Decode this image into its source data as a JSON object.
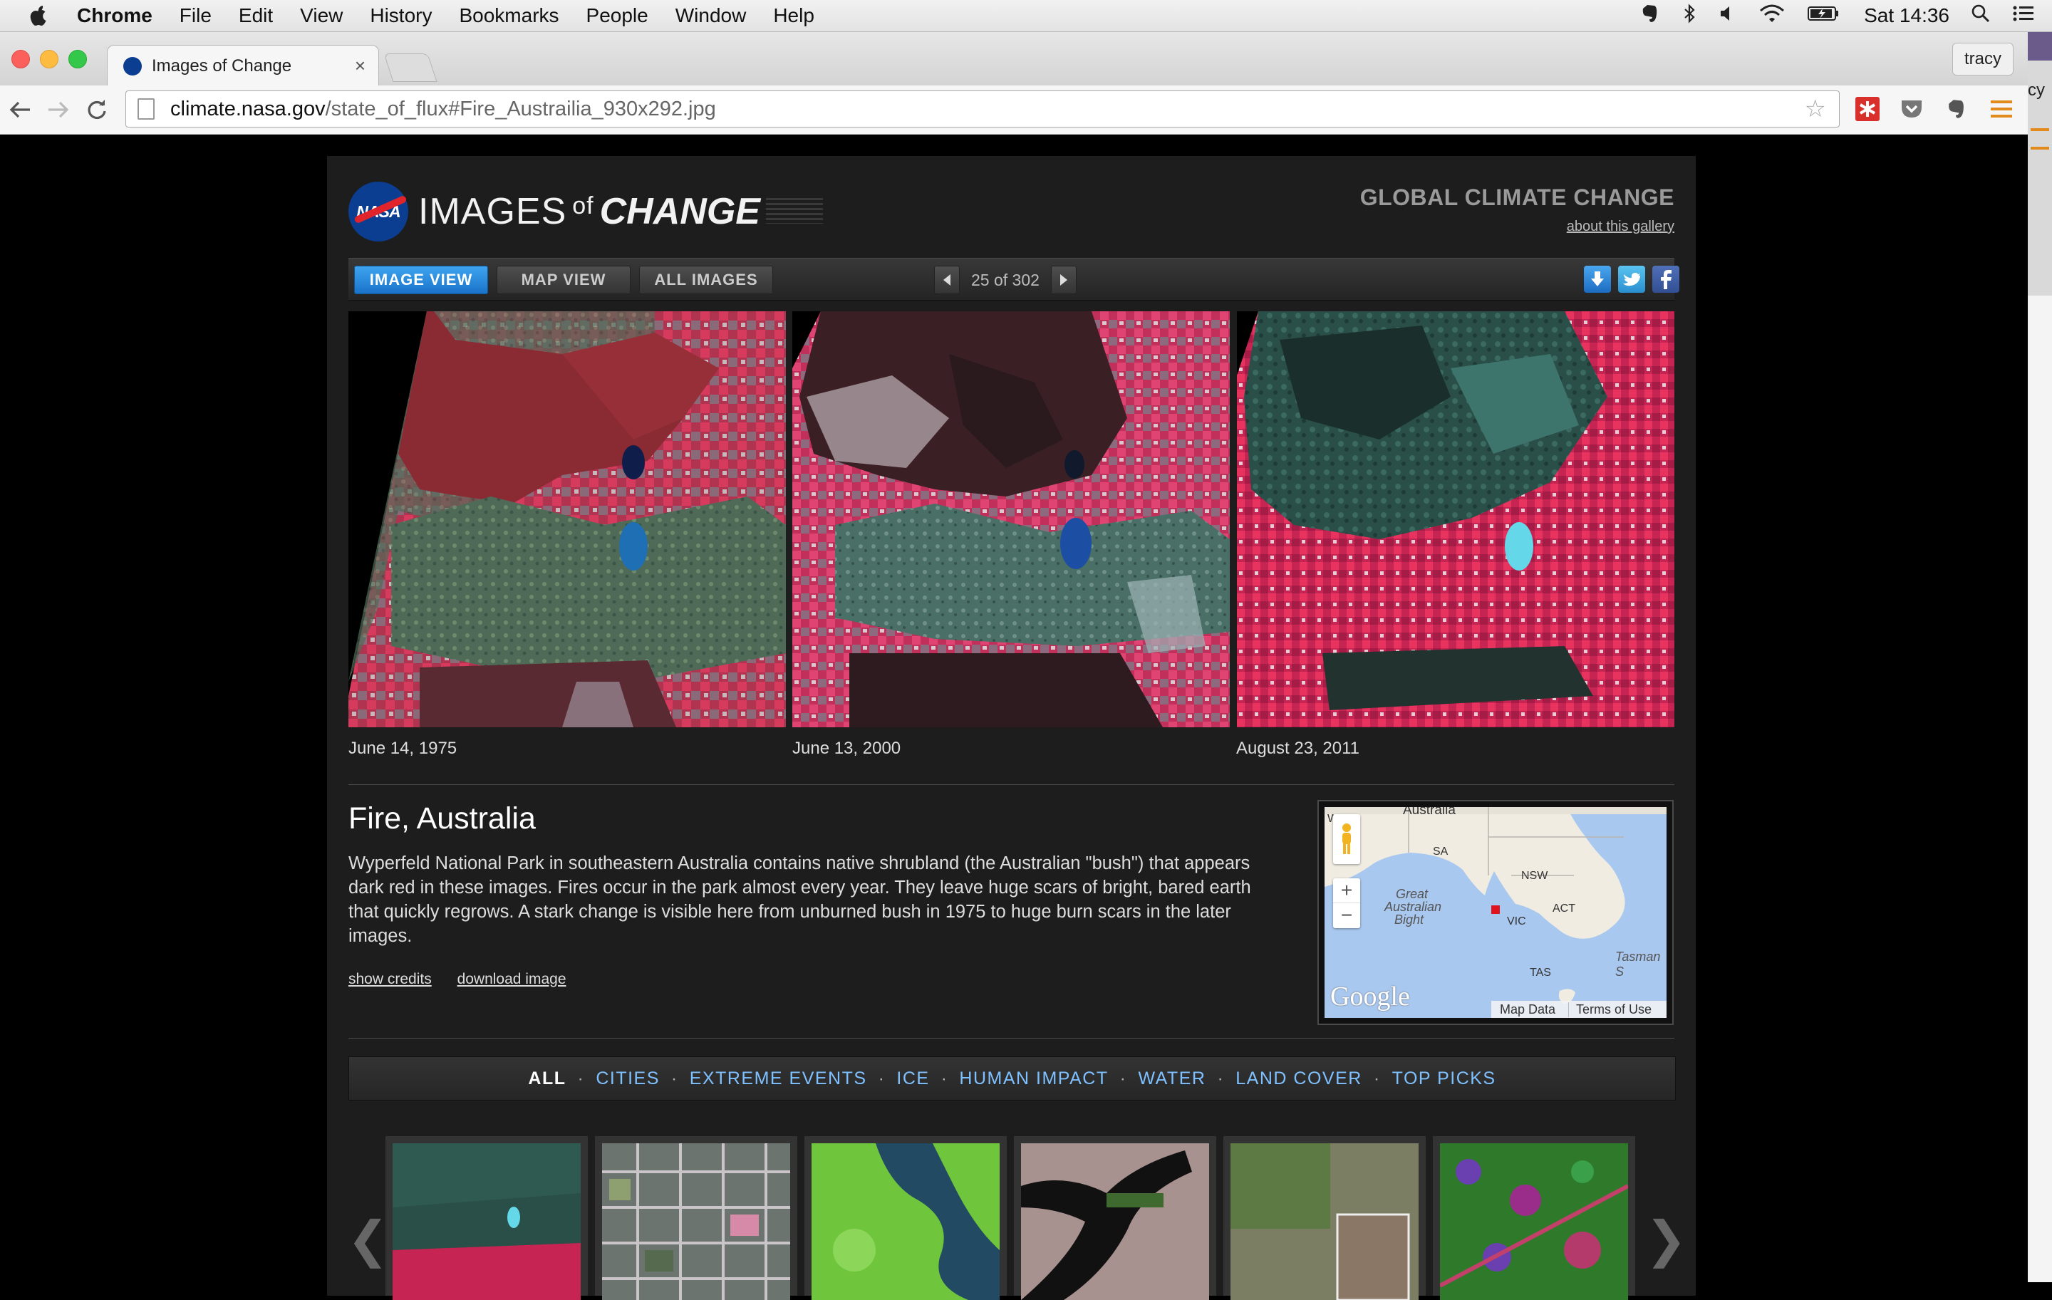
{
  "menubar": {
    "app_name": "Chrome",
    "items": [
      "File",
      "Edit",
      "View",
      "History",
      "Bookmarks",
      "People",
      "Window",
      "Help"
    ],
    "clock": "Sat 14:36"
  },
  "browser": {
    "tab_title": "Images of Change",
    "tab_close": "×",
    "profile_name": "tracy",
    "url_host": "climate.nasa.gov",
    "url_path": "/state_of_flux#Fire_Austrailia_930x292.jpg",
    "background_window_text": "cy"
  },
  "header": {
    "brand_images": "IMAGES",
    "brand_of": "of",
    "brand_change": "CHANGE",
    "logo_text": "NASA",
    "section_title": "GLOBAL CLIMATE CHANGE",
    "about_link": "about this gallery"
  },
  "viewbar": {
    "image_view": "IMAGE VIEW",
    "map_view": "MAP VIEW",
    "all_images": "ALL IMAGES",
    "counter": "25 of 302"
  },
  "images": {
    "captions": [
      "June 14, 1975",
      "June 13, 2000",
      "August 23, 2011"
    ]
  },
  "article": {
    "title": "Fire, Australia",
    "description": "Wyperfeld National Park in southeastern Australia contains native shrubland (the Australian \"bush\") that appears dark red in these images. Fires occur in the park almost every year. They leave huge scars of bright, bared earth that quickly regrows. A stark change is visible here from unburned bush in 1975 to huge burn scars in the later images.",
    "show_credits": "show credits",
    "download_image": "download image"
  },
  "map": {
    "labels": {
      "australia": "Australia",
      "wa": "WA",
      "sa": "SA",
      "nsw": "NSW",
      "act": "ACT",
      "vic": "VIC",
      "tas": "TAS",
      "great": "Great",
      "australian": "Australian",
      "bight": "Bight",
      "tasman": "Tasman S"
    },
    "zoom_in": "+",
    "zoom_out": "−",
    "google": "Google",
    "map_data": "Map Data",
    "terms": "Terms of Use"
  },
  "categories": {
    "items": [
      "ALL",
      "CITIES",
      "EXTREME EVENTS",
      "ICE",
      "HUMAN IMPACT",
      "WATER",
      "LAND COVER",
      "TOP PICKS"
    ],
    "separator": "·"
  },
  "carousel": {
    "prev": "❮",
    "next": "❯"
  },
  "colors": {
    "active_button": "#1a73c9",
    "category_link": "#7fc0ff",
    "nasa_blue": "#0b3d91",
    "nasa_red": "#e0242b",
    "map_marker": "#e0141e"
  }
}
